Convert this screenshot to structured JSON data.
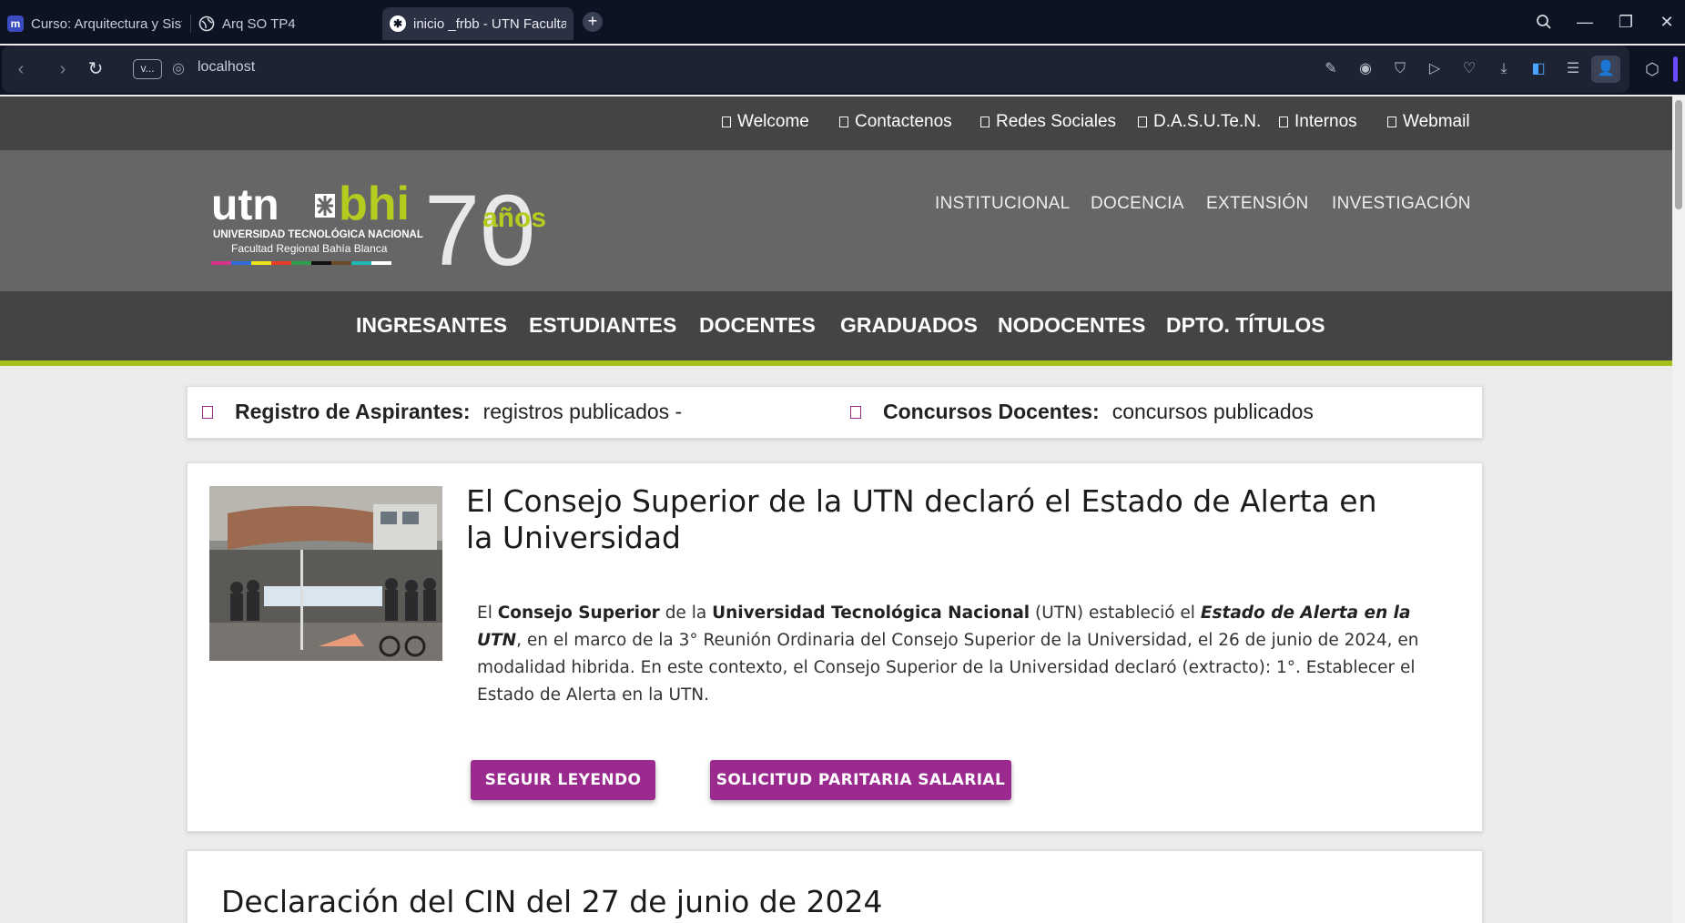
{
  "browser": {
    "tabs": [
      {
        "label": "Curso: Arquitectura y Siste",
        "icon": "moodle-icon"
      },
      {
        "label": "Arq SO TP4",
        "icon": "globe-icon"
      },
      {
        "label": "inicio _frbb - UTN Facultad",
        "icon": "utn-icon"
      }
    ],
    "new_tab": "+",
    "url": "localhost",
    "address_pill": "v..."
  },
  "site": {
    "top_links": [
      "Welcome",
      "Contactenos",
      "Redes Sociales",
      "D.A.S.U.Te.N.",
      "Internos",
      "Webmail"
    ],
    "logo": {
      "utn": "utn",
      "bhi": "bhi",
      "line1": "UNIVERSIDAD TECNOLÓGICA NACIONAL",
      "line2": "Facultad Regional Bahía Blanca",
      "anniversary": "70",
      "anos": "años"
    },
    "main_nav": [
      "INSTITUCIONAL",
      "DOCENCIA",
      "EXTENSIÓN",
      "INVESTIGACIÓN"
    ],
    "categories": [
      "INGRESANTES",
      "ESTUDIANTES",
      "DOCENTES",
      "GRADUADOS",
      "NODOCENTES",
      "DPTO. TÍTULOS"
    ],
    "notices": [
      {
        "title": "Registro de Aspirantes:",
        "text": "registros publicados -"
      },
      {
        "title": "Concursos Docentes:",
        "text": "concursos publicados"
      }
    ],
    "article1": {
      "title": "El Consejo Superior de la UTN declaró el Estado de Alerta en la Universidad",
      "p1": "El ",
      "b1": "Consejo Superior",
      "p2": " de la ",
      "b2": "Universidad Tecnológica Nacional",
      "p3": " (UTN) estableció el ",
      "i1": "Estado de Alerta en la UTN",
      "p4": ", en el marco de la 3° Reunión Ordinaria del Consejo Superior de la Universidad, el 26 de junio de 2024, en modalidad hibrida. En este contexto, el Consejo Superior de la Universidad declaró (extracto): 1°. Establecer el Estado de Alerta en la UTN.",
      "buttons": [
        "SEGUIR LEYENDO",
        "SOLICITUD PARITARIA SALARIAL"
      ]
    },
    "article2": {
      "title": "Declaración del CIN del 27 de junio de 2024"
    }
  },
  "colors": {
    "accent_purple": "#9b2a8f",
    "accent_green": "#a5c21c",
    "header_gray": "#666666",
    "bar_dark": "#444444"
  }
}
